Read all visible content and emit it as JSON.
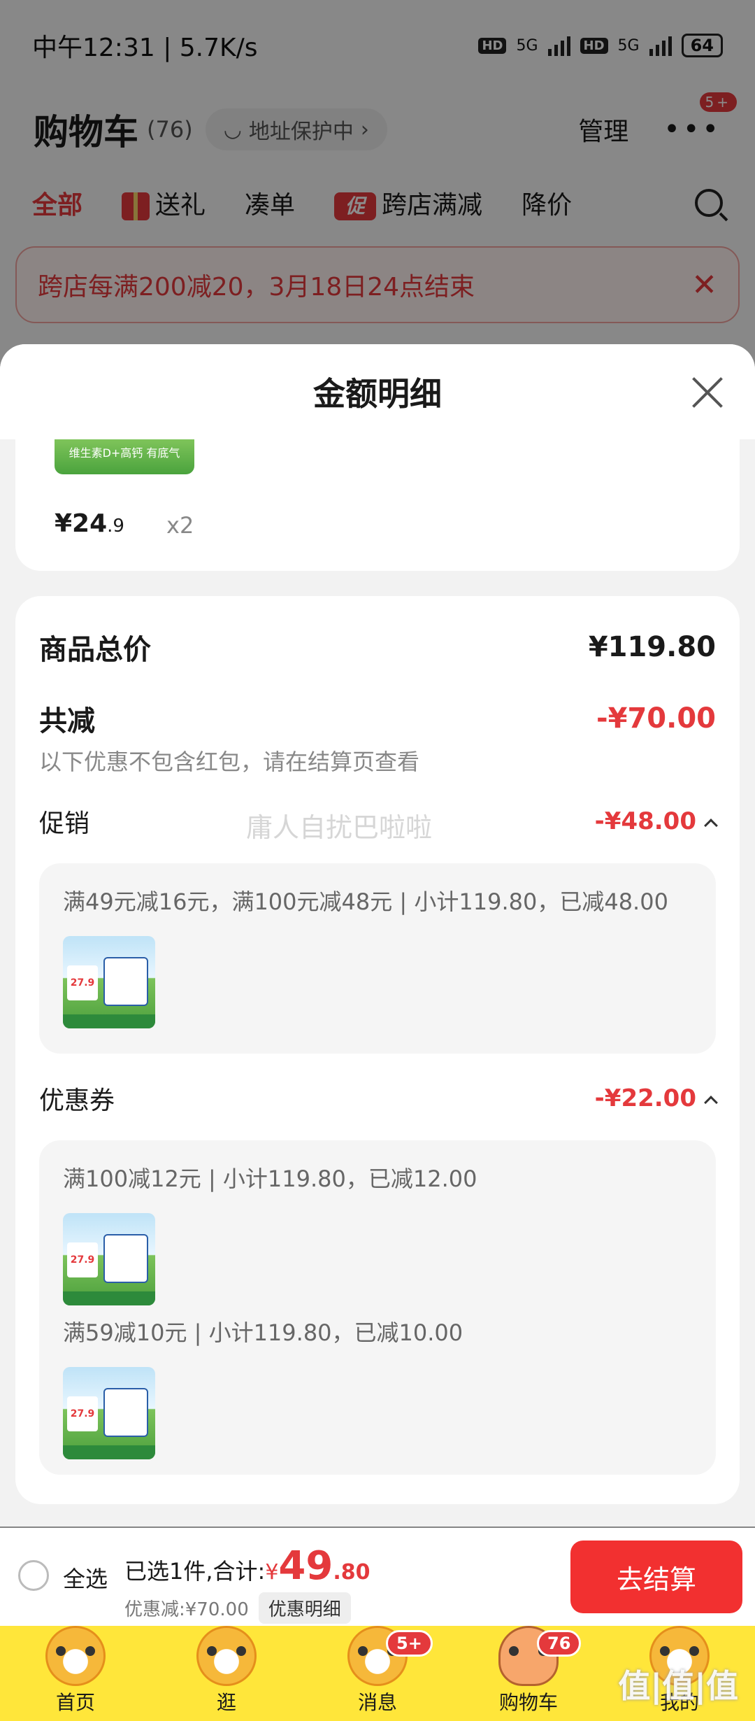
{
  "status": {
    "time": "中午12:31 | 5.7K/s",
    "net1": "5G",
    "net2": "5G",
    "hd": "HD",
    "battery": "64"
  },
  "header": {
    "title": "购物车",
    "count": "(76)",
    "address": "地址保护中",
    "manage": "管理",
    "more_badge": "5+"
  },
  "tabs": [
    {
      "label": "全部"
    },
    {
      "label": "送礼"
    },
    {
      "label": "凑单"
    },
    {
      "label": "跨店满减",
      "icon_text": "促"
    },
    {
      "label": "降价"
    }
  ],
  "notice": {
    "text": "跨店每满200减20，3月18日24点结束"
  },
  "sheet": {
    "title": "金额明细",
    "item": {
      "thumb_text": "维生素D+高钙 有底气",
      "price_main": "¥24",
      "price_dec": ".9",
      "qty": "x2"
    },
    "total_label": "商品总价",
    "total_value": "¥119.80",
    "reduce_label": "共减",
    "reduce_value": "-¥70.00",
    "reduce_note": "以下优惠不包含红包，请在结算页查看",
    "watermark": "庸人自扰巴啦啦",
    "promo": {
      "label": "促销",
      "value": "-¥48.00",
      "lines": [
        "满49元减16元，满100元减48元 | 小计119.80，已减48.00"
      ]
    },
    "coupon": {
      "label": "优惠券",
      "value": "-¥22.00",
      "lines": [
        "满100减12元 | 小计119.80，已减12.00",
        "满59减10元 | 小计119.80，已减10.00"
      ]
    },
    "product_tag": "27.9"
  },
  "checkout": {
    "select_all": "全选",
    "selected_text": "已选1件,合计:",
    "currency": "¥",
    "total_int": "49",
    "total_dec": ".80",
    "saved": "优惠减:¥70.00",
    "detail_btn": "优惠明细",
    "submit": "去结算"
  },
  "tabbar": [
    {
      "label": "首页",
      "badge": ""
    },
    {
      "label": "逛",
      "badge": ""
    },
    {
      "label": "消息",
      "badge": "5+"
    },
    {
      "label": "购物车",
      "badge": "76"
    },
    {
      "label": "我的",
      "badge": ""
    }
  ],
  "corner_watermark": "值|值|值"
}
